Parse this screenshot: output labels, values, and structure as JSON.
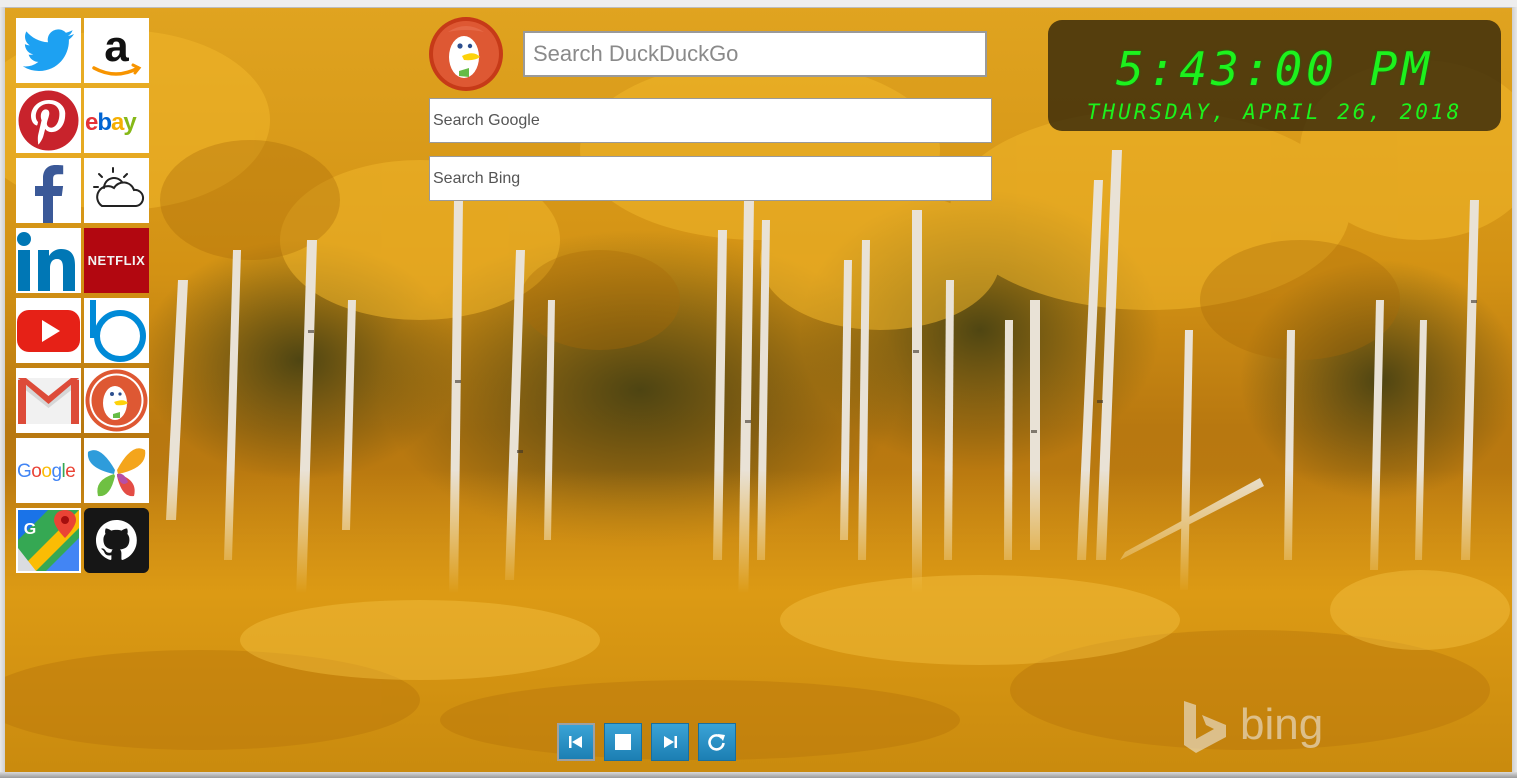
{
  "shortcuts": [
    {
      "name": "Twitter",
      "icon": "twitter-icon"
    },
    {
      "name": "Amazon",
      "icon": "amazon-icon",
      "label": "a"
    },
    {
      "name": "Pinterest",
      "icon": "pinterest-icon"
    },
    {
      "name": "eBay",
      "icon": "ebay-icon",
      "label": "ebay"
    },
    {
      "name": "Facebook",
      "icon": "facebook-icon",
      "label": "f"
    },
    {
      "name": "Weather",
      "icon": "weather-icon"
    },
    {
      "name": "LinkedIn",
      "icon": "linkedin-icon",
      "label": "in"
    },
    {
      "name": "Netflix",
      "icon": "netflix-icon",
      "label": "NETFLIX"
    },
    {
      "name": "YouTube",
      "icon": "youtube-icon"
    },
    {
      "name": "Bing",
      "icon": "bing-icon",
      "label": "b"
    },
    {
      "name": "Gmail",
      "icon": "gmail-icon"
    },
    {
      "name": "DuckDuckGo",
      "icon": "duckduckgo-icon"
    },
    {
      "name": "Google",
      "icon": "google-icon",
      "label": "Google"
    },
    {
      "name": "MSN",
      "icon": "msn-butterfly-icon"
    },
    {
      "name": "Google Maps",
      "icon": "google-maps-icon",
      "label": "G"
    },
    {
      "name": "GitHub",
      "icon": "github-icon"
    }
  ],
  "search": {
    "duckduckgo_placeholder": "Search DuckDuckGo",
    "google_placeholder": "Search Google",
    "bing_placeholder": "Search Bing"
  },
  "clock": {
    "time": "5:43:00 PM",
    "date": "THURSDAY, APRIL 26, 2018"
  },
  "watermark": {
    "text": "bing"
  },
  "controls": [
    {
      "name": "previous",
      "icon": "skip-previous-icon"
    },
    {
      "name": "stop",
      "icon": "stop-icon"
    },
    {
      "name": "next",
      "icon": "skip-next-icon"
    },
    {
      "name": "refresh",
      "icon": "refresh-icon"
    }
  ],
  "colors": {
    "clock_text": "#1df21d",
    "control_blue": "#2a93c8",
    "twitter": "#1da1f2",
    "pinterest": "#c8232c",
    "facebook": "#3b5998",
    "linkedin": "#0077b5",
    "netflix": "#b20710",
    "youtube": "#e62117",
    "bing": "#008ad7",
    "github": "#161616"
  }
}
